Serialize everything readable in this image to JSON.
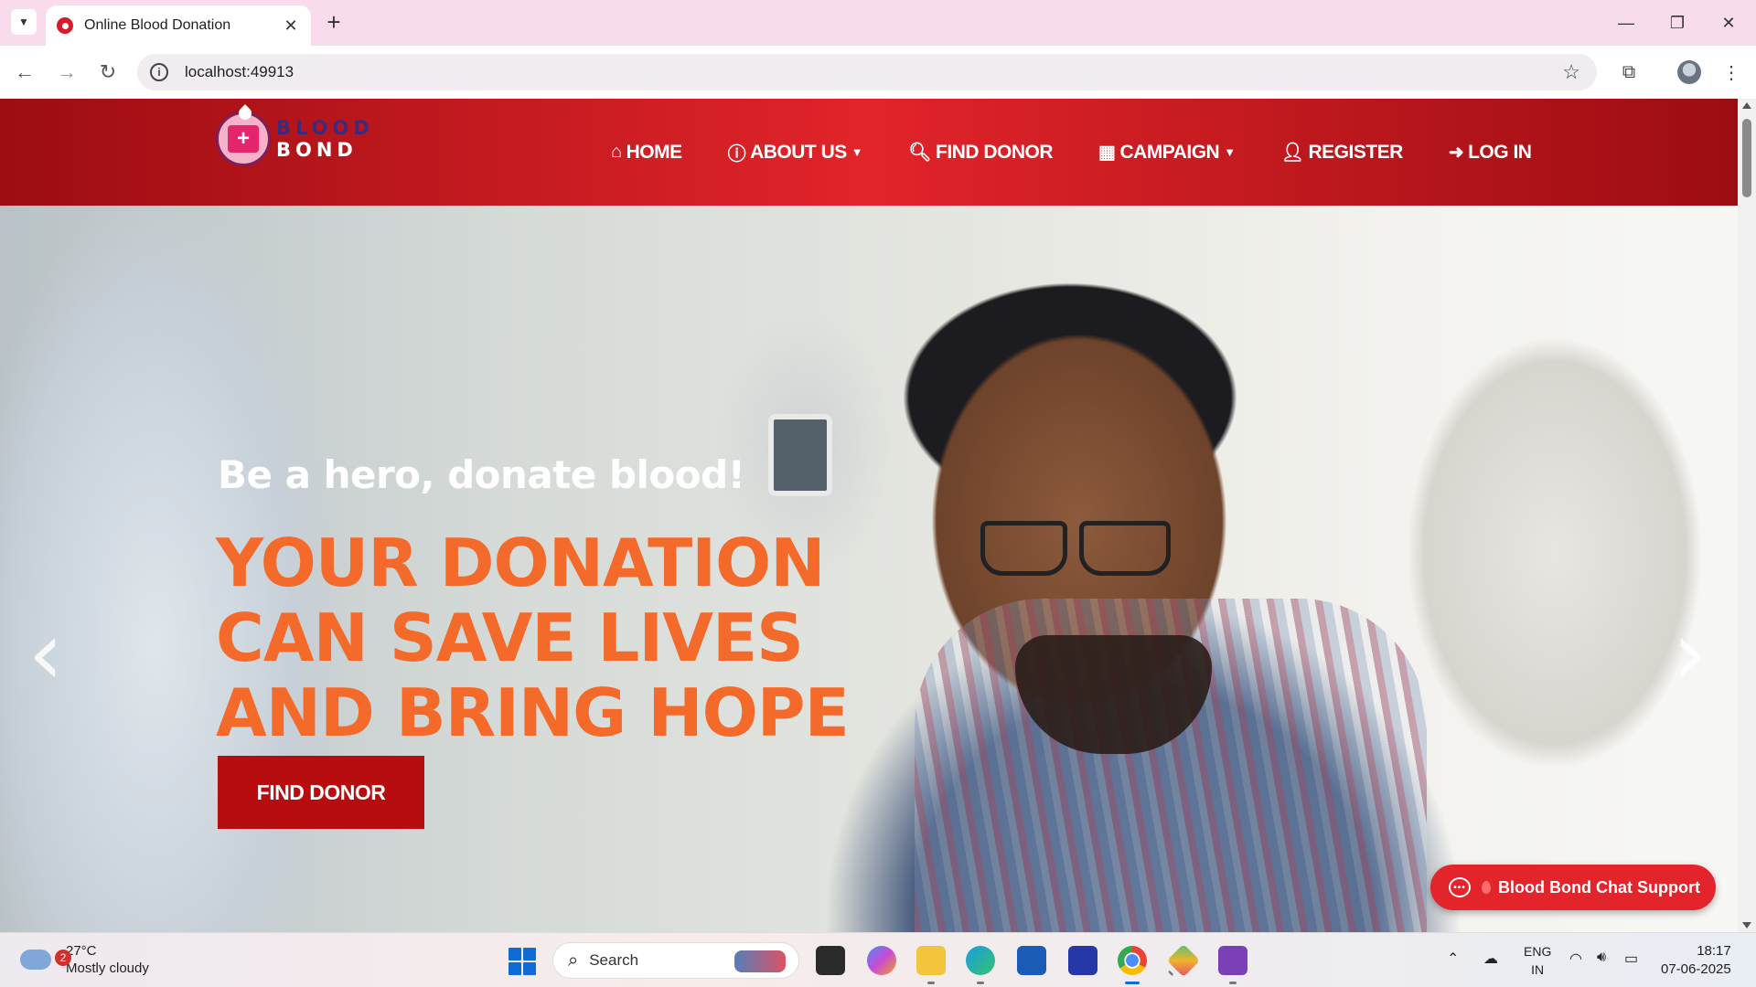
{
  "browser": {
    "tab_title": "Online Blood Donation",
    "tab_close": "✕",
    "new_tab": "+",
    "url": "localhost:49913",
    "controls": {
      "minimize": "—",
      "restore": "❐",
      "close": "✕"
    }
  },
  "site": {
    "logo": {
      "line1": "BLOOD",
      "line2": "BOND"
    },
    "menu": [
      {
        "label": "HOME",
        "icon": "home-icon",
        "glyph": "⌂",
        "dropdown": false
      },
      {
        "label": "ABOUT US",
        "icon": "info-icon",
        "glyph": "ⓘ",
        "dropdown": true
      },
      {
        "label": "FIND DONOR",
        "icon": "search-icon",
        "glyph": "🔍︎",
        "dropdown": false
      },
      {
        "label": "CAMPAIGN",
        "icon": "calendar-icon",
        "glyph": "▦",
        "dropdown": true
      },
      {
        "label": "REGISTER",
        "icon": "user-plus-icon",
        "glyph": "👤︎",
        "dropdown": false
      },
      {
        "label": "LOG IN",
        "icon": "sign-in-icon",
        "glyph": "➜",
        "dropdown": false
      }
    ],
    "hero": {
      "subtitle": "Be a hero, donate blood!",
      "title_lines": [
        "YOUR DONATION",
        "CAN SAVE LIVES",
        "AND BRING HOPE"
      ],
      "button": "FIND DONOR",
      "prev": "‹",
      "next": "›"
    },
    "chat": {
      "label": "Blood Bond Chat Support",
      "icon_text": "•••"
    }
  },
  "taskbar": {
    "weather": {
      "alerts": "2",
      "temp": "27°C",
      "condition": "Mostly cloudy"
    },
    "search_placeholder": "Search",
    "language": {
      "line1": "ENG",
      "line2": "IN"
    },
    "time": "18:17",
    "date": "07-06-2025"
  },
  "colors": {
    "nav_gradient_dark": "#9c0d12",
    "nav_gradient_light": "#e1242a",
    "hero_title": "#f36a2a",
    "cta": "#b80d0f",
    "chat": "#e3242b"
  }
}
